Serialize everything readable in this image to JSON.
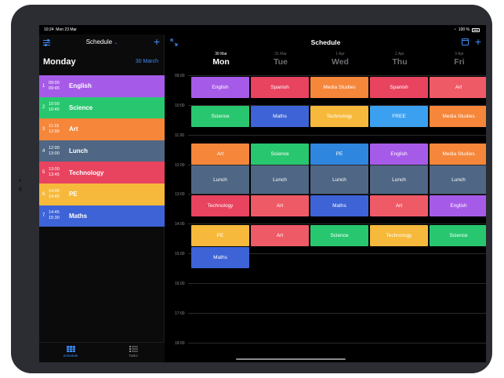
{
  "status_bar": {
    "time": "10:24",
    "date": "Mon 23 Mar",
    "battery": "100 %"
  },
  "sidebar": {
    "title": "Schedule",
    "day_name": "Monday",
    "day_date": "30 March",
    "lessons": [
      {
        "num": "1",
        "start": "09:00",
        "end": "09:45",
        "subject": "English",
        "color": "#a65be8"
      },
      {
        "num": "2",
        "start": "10:00",
        "end": "10:45",
        "subject": "Science",
        "color": "#28c76f"
      },
      {
        "num": "3",
        "start": "11:15",
        "end": "12:00",
        "subject": "Art",
        "color": "#f5863a"
      },
      {
        "num": "4",
        "start": "12:00",
        "end": "13:00",
        "subject": "Lunch",
        "color": "#4f6784"
      },
      {
        "num": "5",
        "start": "13:00",
        "end": "13:45",
        "subject": "Technology",
        "color": "#e8435f"
      },
      {
        "num": "6",
        "start": "14:00",
        "end": "14:45",
        "subject": "PE",
        "color": "#f6b93b"
      },
      {
        "num": "7",
        "start": "14:45",
        "end": "15:30",
        "subject": "Maths",
        "color": "#3d63d7"
      }
    ],
    "tabs": {
      "schedule": "Schedule",
      "tasks": "Tasks"
    }
  },
  "main": {
    "title": "Schedule",
    "days": [
      {
        "date": "30 Mar",
        "name": "Mon",
        "active": true
      },
      {
        "date": "31 Mar",
        "name": "Tue",
        "active": false
      },
      {
        "date": "1 Apr",
        "name": "Wed",
        "active": false
      },
      {
        "date": "2 Apr",
        "name": "Thu",
        "active": false
      },
      {
        "date": "3 Apr",
        "name": "Fri",
        "active": false
      }
    ],
    "hours": [
      "09:00",
      "10:00",
      "11:00",
      "12:00",
      "13:00",
      "14:00",
      "15:00",
      "16:00",
      "17:00",
      "18:00"
    ],
    "colors": {
      "English": "#a65be8",
      "Spanish": "#e8435f",
      "Media Studies": "#f5863a",
      "Art": "#ef5a67",
      "Science": "#28c76f",
      "Maths": "#3d63d7",
      "Technology": "#f6b93b",
      "FREE": "#3ba0f0",
      "Lunch": "#4f6784",
      "PE": "#2e86de"
    },
    "rows": [
      [
        "English",
        "Spanish",
        "Media Studies",
        "Spanish",
        "Art"
      ],
      [
        "Science",
        "Maths",
        "Technology",
        "FREE",
        "Media Studies"
      ],
      [
        "Art",
        "Science",
        "PE",
        "English",
        "Media Studies"
      ],
      [
        "Lunch",
        "Lunch",
        "Lunch",
        "Lunch",
        "Lunch"
      ],
      [
        "Technology",
        "Art",
        "Maths",
        "Art",
        "English"
      ],
      [
        "PE",
        "Art",
        "Science",
        "Technology",
        "Science"
      ],
      [
        "Maths",
        "",
        "",
        "",
        ""
      ]
    ],
    "cell_overrides": {
      "0-0": "#a65be8",
      "2-0": "#f5863a",
      "4-0": "#e8435f",
      "5-0": "#f6b93b",
      "2-2": "#2e86de",
      "5-1": "#ef5a67",
      "4-1": "#ef5a67",
      "4-3": "#ef5a67"
    }
  }
}
